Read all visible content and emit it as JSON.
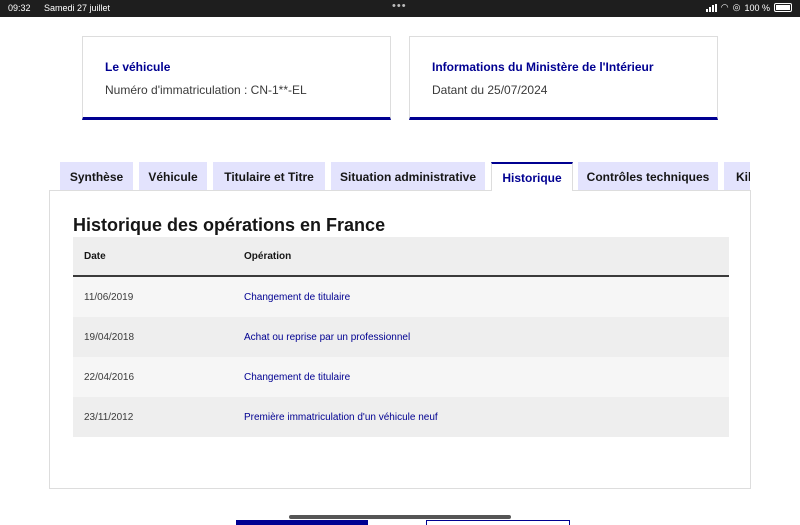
{
  "status_bar": {
    "time": "09:32",
    "date": "Samedi 27 juillet",
    "battery": "100 %"
  },
  "cards": [
    {
      "title": "Le véhicule",
      "value": "Numéro d'immatriculation : CN-1**-EL"
    },
    {
      "title": "Informations du Ministère de l'Intérieur",
      "value": "Datant du 25/07/2024"
    }
  ],
  "tabs": [
    {
      "label": "Synthèse"
    },
    {
      "label": "Véhicule"
    },
    {
      "label": "Titulaire et Titre"
    },
    {
      "label": "Situation administrative"
    },
    {
      "label": "Historique",
      "active": true
    },
    {
      "label": "Contrôles techniques"
    },
    {
      "label": "Kilo"
    }
  ],
  "history": {
    "title": "Historique des opérations en France",
    "columns": [
      "Date",
      "Opération"
    ],
    "rows": [
      {
        "date": "11/06/2019",
        "operation": "Changement de titulaire"
      },
      {
        "date": "19/04/2018",
        "operation": "Achat ou reprise par un professionnel"
      },
      {
        "date": "22/04/2016",
        "operation": "Changement de titulaire"
      },
      {
        "date": "23/11/2012",
        "operation": "Première immatriculation d'un véhicule neuf"
      }
    ]
  },
  "colors": {
    "accent": "#000091",
    "tab_bg": "#e3e3fd",
    "row_alt": "#eeeeee"
  }
}
